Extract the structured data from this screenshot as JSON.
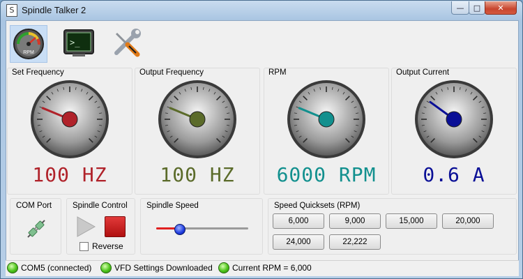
{
  "window": {
    "title": "Spindle Talker 2",
    "minimize_glyph": "—",
    "maximize_glyph": "□",
    "close_glyph": "✕"
  },
  "toolbar": [
    {
      "name": "gauge-icon",
      "label": "RPM",
      "active": true
    },
    {
      "name": "terminal-icon",
      "label": ">_",
      "active": false
    },
    {
      "name": "wrench-screwdriver-icon",
      "label": "",
      "active": false
    }
  ],
  "gauges": [
    {
      "label": "Set Frequency",
      "value": 100,
      "max": 400,
      "readout": "100 HZ",
      "color": "#b0222a",
      "needle_fraction": 0.25
    },
    {
      "label": "Output Frequency",
      "value": 100,
      "max": 400,
      "readout": "100 HZ",
      "color": "#5b6b2a",
      "needle_fraction": 0.25
    },
    {
      "label": "RPM",
      "value": 6000,
      "max": 24000,
      "readout": "6000 RPM",
      "color": "#12908e",
      "needle_fraction": 0.25
    },
    {
      "label": "Output Current",
      "value": 0.6,
      "max": 2,
      "readout": "0.6 A",
      "color": "#0a0f96",
      "needle_fraction": 0.3
    }
  ],
  "com_port": {
    "label": "COM Port"
  },
  "spindle_control": {
    "label": "Spindle Control",
    "reverse_label": "Reverse",
    "reverse_checked": false
  },
  "spindle_speed": {
    "label": "Spindle Speed",
    "slider_fraction": 0.25
  },
  "quicksets": {
    "label": "Speed Quicksets (RPM)",
    "buttons": [
      "6,000",
      "9,000",
      "15,000",
      "20,000",
      "24,000",
      "22,222"
    ]
  },
  "status": [
    {
      "text": "COM5 (connected)"
    },
    {
      "text": "VFD Settings Downloaded"
    },
    {
      "text": "Current RPM = 6,000"
    }
  ]
}
